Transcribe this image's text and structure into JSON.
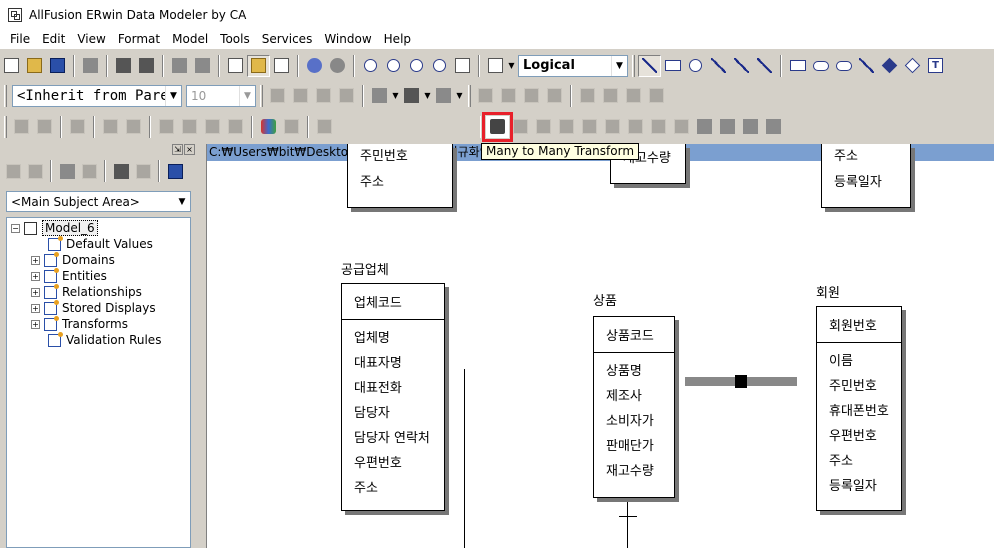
{
  "app": {
    "title": "AllFusion ERwin Data Modeler by CA"
  },
  "menu": [
    "File",
    "Edit",
    "View",
    "Format",
    "Model",
    "Tools",
    "Services",
    "Window",
    "Help"
  ],
  "toolbar": {
    "view_combo": "Logical",
    "font_combo": "<Inherit from Parei",
    "size_combo": "10",
    "tooltip": "Many to Many Transform"
  },
  "left_panel": {
    "subject_area": "<Main Subject Area>",
    "tree": {
      "root": "Model_6",
      "children": [
        "Default Values",
        "Domains",
        "Entities",
        "Relationships",
        "Stored Displays",
        "Transforms",
        "Validation Rules"
      ]
    }
  },
  "diagram": {
    "path": "C:₩Users₩bit₩Desktop₩SQL 수업₩2_ 정규화연습₩                 <Main Subject Area>*",
    "entities": [
      {
        "name": "",
        "pk": "",
        "attrs": [
          "주민번호",
          "주소"
        ]
      },
      {
        "name": "",
        "pk": "",
        "attrs": [
          "재고수량"
        ]
      },
      {
        "name": "",
        "pk": "",
        "attrs": [
          "주소",
          "등록일자"
        ]
      },
      {
        "name": "공급업체",
        "pk": "업체코드",
        "attrs": [
          "업체명",
          "대표자명",
          "대표전화",
          "담당자",
          "담당자 연락처",
          "우편번호",
          "주소"
        ]
      },
      {
        "name": "상품",
        "pk": "상품코드",
        "attrs": [
          "상품명",
          "제조사",
          "소비자가",
          "판매단가",
          "재고수량"
        ]
      },
      {
        "name": "회원",
        "pk": "회원번호",
        "attrs": [
          "이름",
          "주민번호",
          "휴대폰번호",
          "우편번호",
          "주소",
          "등록일자"
        ]
      }
    ]
  }
}
